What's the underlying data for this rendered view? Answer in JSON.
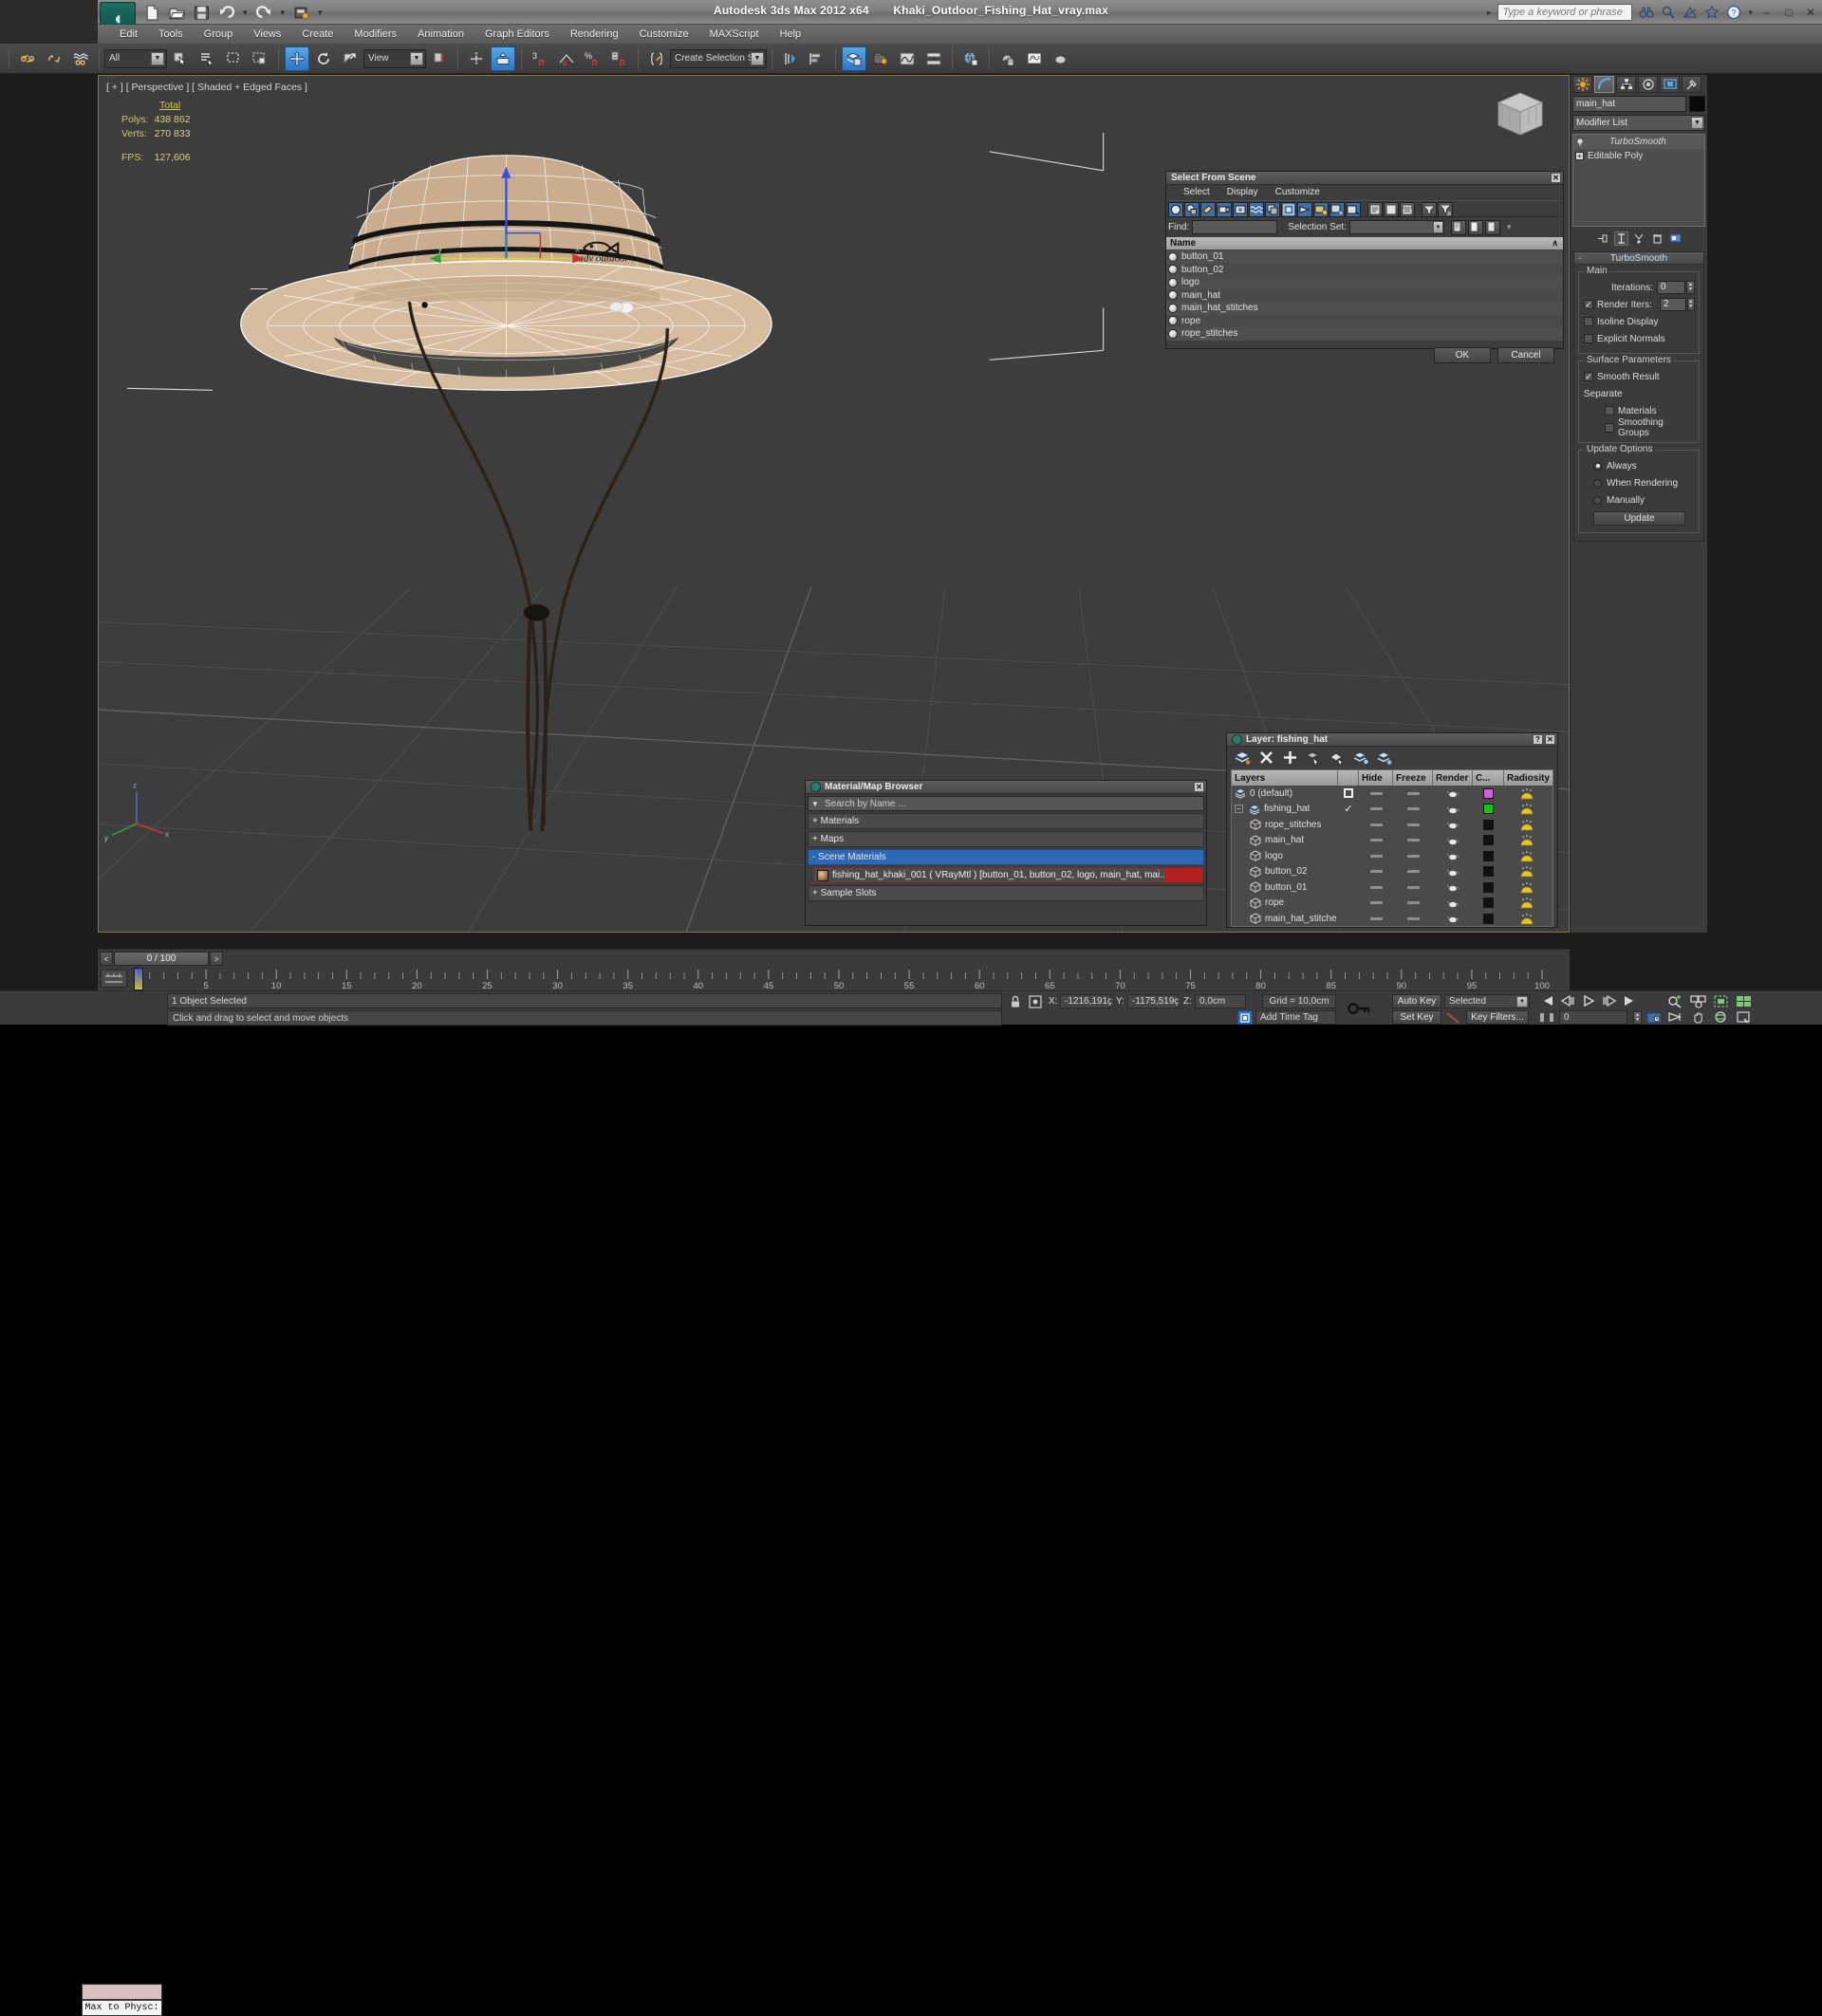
{
  "app": {
    "title": "Autodesk 3ds Max  2012 x64",
    "file": "Khaki_Outdoor_Fishing_Hat_vray.max",
    "search_placeholder": "Type a keyword or phrase",
    "minimize": "–",
    "maximize": "□",
    "close": "✕"
  },
  "menu": {
    "items": [
      "Edit",
      "Tools",
      "Group",
      "Views",
      "Create",
      "Modifiers",
      "Animation",
      "Graph Editors",
      "Rendering",
      "Customize",
      "MAXScript",
      "Help"
    ]
  },
  "toolbar": {
    "selection_filter": "All",
    "reference_coord": "View",
    "named_selection_set": "Create Selection Se",
    "snap_angle": "3",
    "snap_percent": "%"
  },
  "viewport": {
    "label": "[ + ] [ Perspective ] [ Shaded + Edged Faces ]",
    "stats": {
      "header": "Total",
      "polys_label": "Polys:",
      "polys_value": "438 862",
      "verts_label": "Verts:",
      "verts_value": "270 833",
      "fps_label": "FPS:",
      "fps_value": "127,606"
    },
    "logo_text": "adv outdoor"
  },
  "command_panel": {
    "object_name": "main_hat",
    "modifier_list_label": "Modifier List",
    "stack": [
      {
        "label": "TurboSmooth",
        "type": "modifier"
      },
      {
        "label": "Editable Poly",
        "type": "base"
      }
    ],
    "rollout": {
      "title": "TurboSmooth",
      "collapse": "-",
      "main_group": "Main",
      "iterations_label": "Iterations:",
      "iterations_value": "0",
      "render_iters_label": "Render Iters:",
      "render_iters_value": "2",
      "render_iters_checked": true,
      "isoline_display": "Isoline Display",
      "explicit_normals": "Explicit Normals",
      "surface_params_group": "Surface Parameters",
      "smooth_result": "Smooth Result",
      "smooth_result_checked": true,
      "separate_label": "Separate",
      "materials": "Materials",
      "smoothing_groups": "Smoothing Groups",
      "update_options_group": "Update Options",
      "always": "Always",
      "when_rendering": "When Rendering",
      "manually": "Manually",
      "update_button": "Update",
      "selected_update_mode": "Always"
    }
  },
  "select_from_scene": {
    "title": "Select From Scene",
    "menus": [
      "Select",
      "Display",
      "Customize"
    ],
    "find_label": "Find:",
    "find_value": "",
    "selection_set_label": "Selection Set:",
    "selection_set_value": "",
    "column_header": "Name",
    "sort_indicator": "∧",
    "items": [
      "button_01",
      "button_02",
      "logo",
      "main_hat",
      "main_hat_stitches",
      "rope",
      "rope_stitches"
    ],
    "ok": "OK",
    "cancel": "Cancel",
    "close": "✕"
  },
  "material_browser": {
    "title": "Material/Map Browser",
    "search_placeholder": "Search by Name ...",
    "groups": [
      {
        "label": "+ Materials",
        "selected": false
      },
      {
        "label": "+ Maps",
        "selected": false
      },
      {
        "label": "- Scene Materials",
        "selected": true
      }
    ],
    "scene_material": "fishing_hat_khaki_001  ( VRayMtl )  [button_01, button_02, logo, main_hat, mai...",
    "sample_slots": "+ Sample Slots",
    "close": "✕"
  },
  "layer_dialog": {
    "title": "Layer: fishing_hat",
    "help": "?",
    "close": "✕",
    "columns": [
      "Layers",
      "",
      "Hide",
      "Freeze",
      "Render",
      "C...",
      "Radiosity"
    ],
    "rows": [
      {
        "name": "0 (default)",
        "indent": 0,
        "kind": "layer",
        "current": "box",
        "color": "#d060d8"
      },
      {
        "name": "fishing_hat",
        "indent": 0,
        "kind": "layer",
        "current": "check",
        "color": "#18c018"
      },
      {
        "name": "rope_stitches",
        "indent": 1,
        "kind": "object",
        "current": "",
        "color": "#111111"
      },
      {
        "name": "main_hat",
        "indent": 1,
        "kind": "object",
        "current": "",
        "color": "#111111"
      },
      {
        "name": "logo",
        "indent": 1,
        "kind": "object",
        "current": "",
        "color": "#111111"
      },
      {
        "name": "button_02",
        "indent": 1,
        "kind": "object",
        "current": "",
        "color": "#111111"
      },
      {
        "name": "button_01",
        "indent": 1,
        "kind": "object",
        "current": "",
        "color": "#111111"
      },
      {
        "name": "rope",
        "indent": 1,
        "kind": "object",
        "current": "",
        "color": "#111111"
      },
      {
        "name": "main_hat_stitche",
        "indent": 1,
        "kind": "object",
        "current": "",
        "color": "#111111"
      }
    ]
  },
  "timeline": {
    "current_frame_display": "0 / 100",
    "prev": "<",
    "next": ">",
    "ticks": [
      5,
      10,
      15,
      20,
      25,
      30,
      35,
      40,
      45,
      50,
      55,
      60,
      65,
      70,
      75,
      80,
      85,
      90,
      95,
      100
    ],
    "range_start": 0,
    "range_end": 100
  },
  "status_bar": {
    "max_to_physc": "Max to Physc:",
    "selection_status": "1 Object Selected",
    "prompt": "Click and drag to select and move objects",
    "x_label": "X:",
    "x_value": "-1216,191ç",
    "y_label": "Y:",
    "y_value": "-1175,519ç",
    "z_label": "Z:",
    "z_value": "0,0cm",
    "grid": "Grid = 10,0cm",
    "add_time_tag": "Add Time Tag",
    "auto_key": "Auto Key",
    "set_key": "Set Key",
    "key_mode": "Selected",
    "key_filters": "Key Filters...",
    "key_frame_field": "0"
  },
  "colors": {
    "accent_blue": "#2e75c4",
    "viewport_bg": "#3d3d3d",
    "panel_bg": "#3b3b3b",
    "stat_yellow": "#d5c469",
    "hat_khaki": "#c8ab8b",
    "selection_red": "#b41f1f"
  }
}
